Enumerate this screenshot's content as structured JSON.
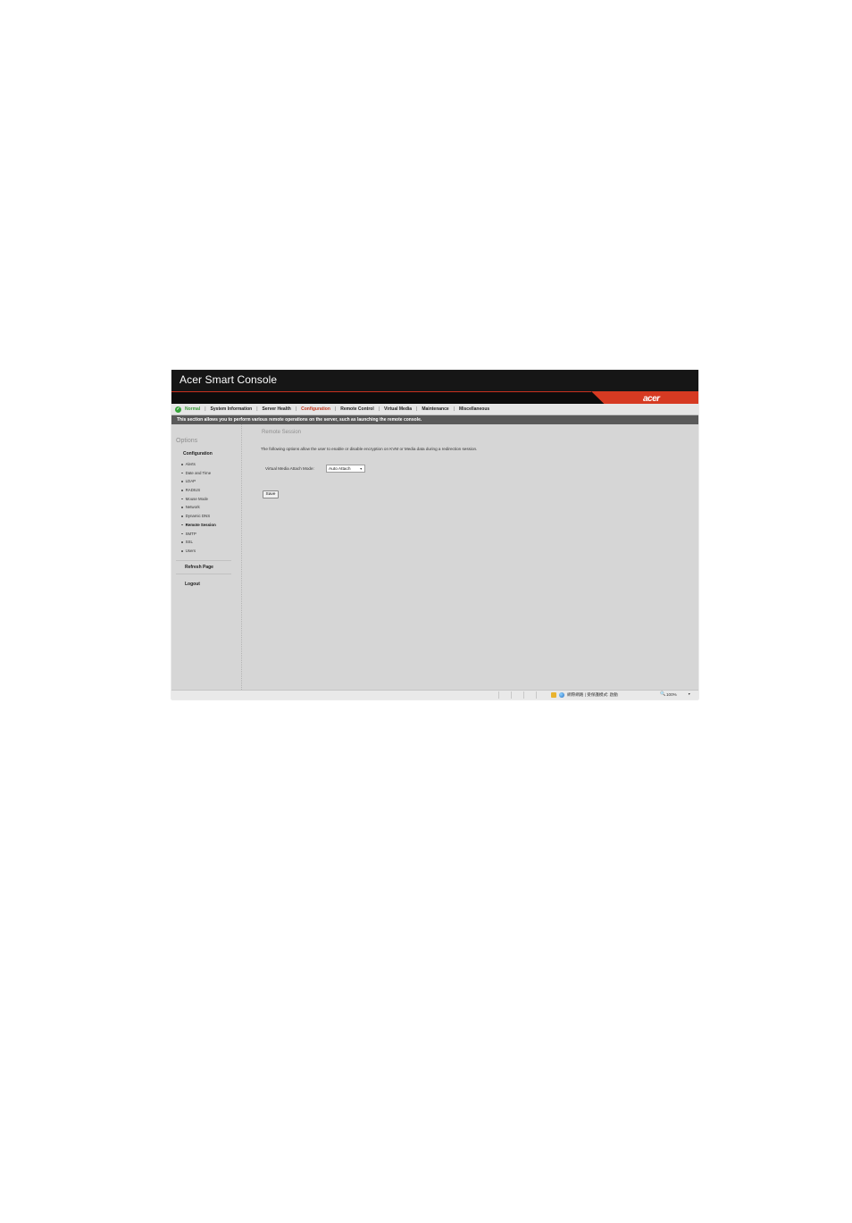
{
  "app": {
    "title": "Acer Smart Console",
    "logo_text": "acer"
  },
  "status": {
    "label": "Normal",
    "color": "#37a53a"
  },
  "nav": {
    "items": [
      {
        "label": "System Information"
      },
      {
        "label": "Server Health"
      },
      {
        "label": "Configuration",
        "active": true
      },
      {
        "label": "Remote Control"
      },
      {
        "label": "Virtual Media"
      },
      {
        "label": "Maintenance"
      },
      {
        "label": "Miscellaneous"
      }
    ]
  },
  "info_bar": "This section allows you to perform various remote operations on the server, such as launching the remote console.",
  "sidebar": {
    "title": "Options",
    "section_heading": "Configuration",
    "items": [
      {
        "label": "Alerts"
      },
      {
        "label": "Date and Time"
      },
      {
        "label": "LDAP"
      },
      {
        "label": "RADIUS"
      },
      {
        "label": "Mouse Mode"
      },
      {
        "label": "Network"
      },
      {
        "label": "Dynamic DNS"
      },
      {
        "label": "Remote Session",
        "active": true
      },
      {
        "label": "SMTP"
      },
      {
        "label": "SSL"
      },
      {
        "label": "Users"
      }
    ],
    "refresh_label": "Refresh Page",
    "logout_label": "Logout"
  },
  "main": {
    "section_title": "Remote Session",
    "description": "The following options allow the user to enable or disable encryption on KVM or Media data during a redirection session.",
    "attach_mode_label": "Virtual Media Attach Mode:",
    "attach_mode_value": "Auto Attach",
    "save_label": "Save"
  },
  "statusbar": {
    "zone_text": "網際網路 | 受保護模式: 啟動",
    "zoom": "100%"
  },
  "colors": {
    "accent_red": "#d63a22",
    "title_bg": "#161616",
    "page_bg": "#d6d6d6",
    "info_bar_bg": "#5a5a5a",
    "active_nav": "#c43a20"
  },
  "icons": [
    "status-ok-icon",
    "bullet-icon",
    "dropdown-arrow-icon",
    "security-zone-icon",
    "globe-icon",
    "zoom-icon",
    "zoom-dropdown-icon"
  ]
}
